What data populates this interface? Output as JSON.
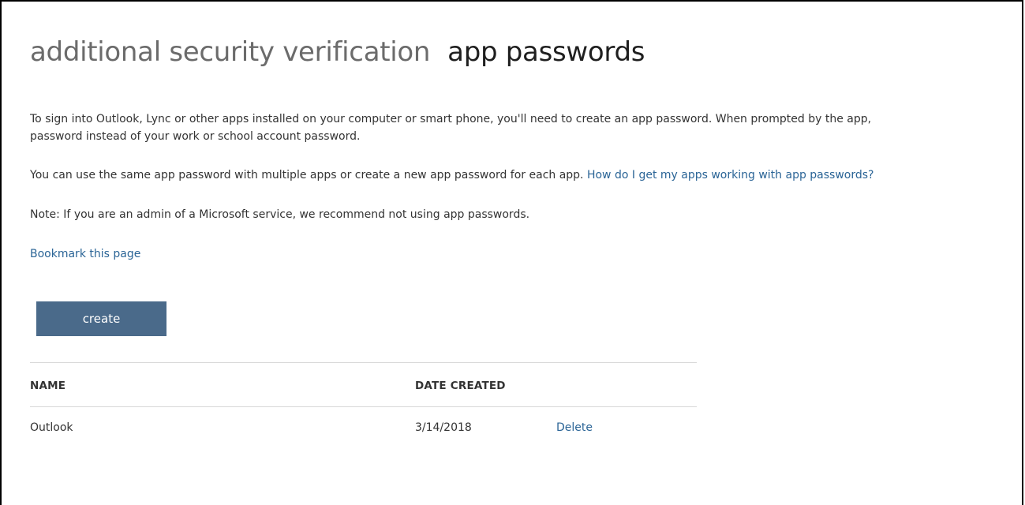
{
  "header": {
    "inactive_title": "additional security verification",
    "active_title": "app passwords"
  },
  "intro": {
    "line1": "To sign into Outlook, Lync or other apps installed on your computer or smart phone, you'll need to create an app password. When prompted by the app,",
    "line2": "password instead of your work or school account password."
  },
  "multi_app": {
    "text": "You can use the same app password with multiple apps or create a new app password for each app. ",
    "link": "How do I get my apps working with app passwords?"
  },
  "note": {
    "text": "Note: If you are an admin of a Microsoft service, we recommend not using app passwords."
  },
  "bookmark_link": "Bookmark this page",
  "create_button": "create",
  "table": {
    "headers": {
      "name": "NAME",
      "date_created": "DATE CREATED"
    },
    "rows": [
      {
        "name": "Outlook",
        "date_created": "3/14/2018",
        "action": "Delete"
      }
    ]
  },
  "colors": {
    "button_bg": "#4a6a8a",
    "link": "#2a6496",
    "border": "#000000"
  }
}
